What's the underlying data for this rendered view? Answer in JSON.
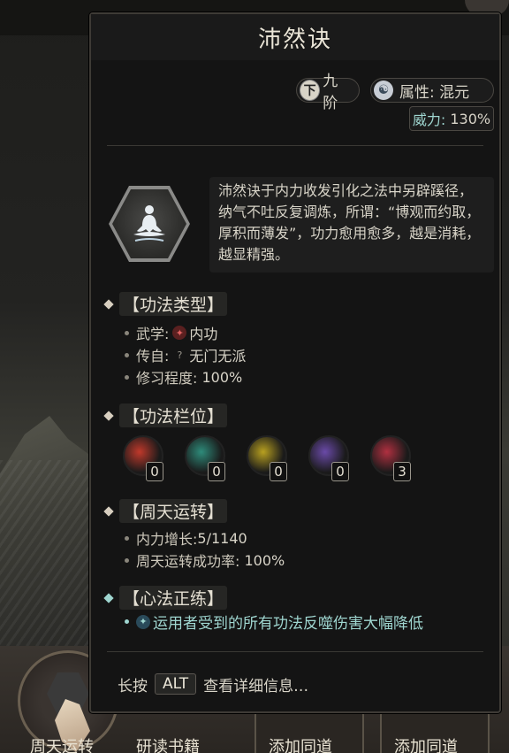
{
  "background": {
    "bottom_labels": [
      "周天运转",
      "研读书籍",
      "添加同道",
      "添加同道"
    ]
  },
  "panel": {
    "title": "沛然诀",
    "grade": {
      "badge": "下",
      "label": "九阶"
    },
    "attribute": "属性: 混元",
    "power": {
      "label": "威力:",
      "value": "130%"
    },
    "description": "沛然诀于内力收发引化之法中另辟蹊径，纳气不吐反复调炼，所谓：“博观而约取，厚积而薄发”，功力愈用愈多，越是消耗，越显精强。",
    "icon": "meditation-icon"
  },
  "type_section": {
    "heading": "【功法类型】",
    "martial_label": "武学:",
    "martial_value": "内功",
    "source_label": "传自:",
    "source_icon_text": "?",
    "source_value": "无门无派",
    "progress_label": "修习程度:",
    "progress_value": "100%"
  },
  "slots_section": {
    "heading": "【功法栏位】",
    "slots": [
      {
        "count": "0",
        "color": "#c0392b"
      },
      {
        "count": "0",
        "color": "#2e8b7a"
      },
      {
        "count": "0",
        "color": "#b8a020"
      },
      {
        "count": "0",
        "color": "#6a4aa8"
      },
      {
        "count": "3",
        "color": "#b03040"
      }
    ]
  },
  "cycle_section": {
    "heading": "【周天运转】",
    "inner_label": "内力增长:",
    "inner_value": "5/1140",
    "rate_label": "周天运转成功率:",
    "rate_value": "100%"
  },
  "heart_section": {
    "heading": "【心法正练】",
    "effect": "运用者受到的所有功法反噬伤害大幅降低"
  },
  "footer": {
    "prefix": "长按",
    "key": "ALT",
    "suffix": "查看详细信息…"
  }
}
